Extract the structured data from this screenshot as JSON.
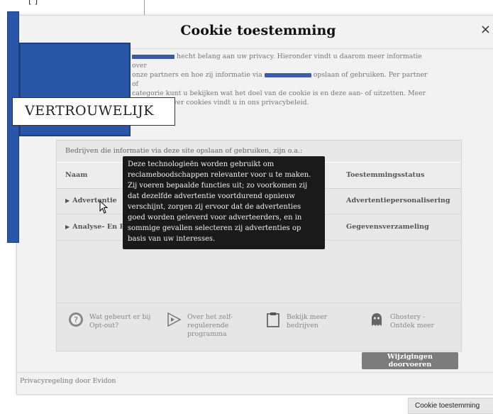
{
  "background": {
    "fragment": "[                                        ]"
  },
  "dialog": {
    "title": "Cookie toestemming",
    "close_label": "×",
    "intro": {
      "part1": " hecht belang aan uw privacy. Hieronder vindt u daarom meer informatie over",
      "part2": "onze partners en hoe zij informatie via ",
      "part3": " opslaan of gebruiken. Per partner of",
      "line3": "categorie kunt u bekijken wat het doel van de cookie is en deze aan- of uitzetten. Meer",
      "line4": "informatie over cookies vindt u in ons privacybeleid."
    },
    "panel": {
      "caption": "Bedrijven die informatie via deze site opslaan of gebruiken, zijn o.a.:",
      "headers": {
        "name": "Naam",
        "status": "Toestemmingsstatus"
      },
      "rows": [
        {
          "name": "Advertentie",
          "status": "Advertentiepersonalisering"
        },
        {
          "name": "Analyse- En P",
          "status": "Gegevensverzameling"
        }
      ],
      "actions": [
        {
          "label": "Wat gebeurt er bij Opt-out?",
          "icon": "question-circle-icon"
        },
        {
          "label": "Over het zelf-regulerende programma",
          "icon": "play-triangle-icon"
        },
        {
          "label": "Bekijk meer bedrijven",
          "icon": "clipboard-icon"
        },
        {
          "label": "Ghostery - Ontdek meer",
          "icon": "ghost-icon"
        }
      ]
    },
    "apply_button": "Wijzigingen doorvoeren",
    "footer": "Privacyregeling door Evidon"
  },
  "tooltip": "Deze technologieën worden gebruikt om reclameboodschappen relevanter voor u te maken. Zij voeren bepaalde functies uit; zo voorkomen zij dat dezelfde advertentie voortdurend opnieuw verschijnt, zorgen zij ervoor dat de advertenties goed worden geleverd voor adverteerders, en in sommige gevallen selecteren zij advertenties op basis van uw interesses.",
  "overlay_label": "VERTROUWELIJK",
  "bottom_chip": "Cookie toestemming",
  "colors": {
    "redaction": "#2a56a8",
    "tooltip_bg": "#1a1a1a",
    "button_bg": "#7c7c7c"
  }
}
